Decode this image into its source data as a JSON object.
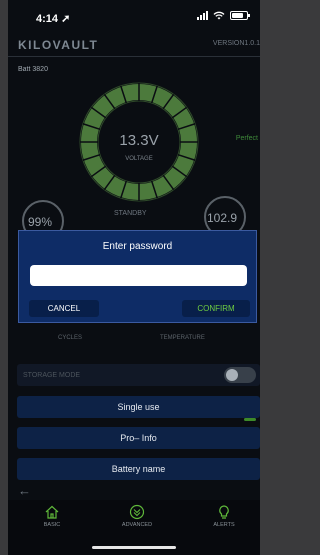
{
  "status_bar": {
    "time": "4:14 ➚"
  },
  "header": {
    "logo": "KILOVAULT",
    "version": "VERSION1.0.1"
  },
  "device": {
    "name": "Batt 3820",
    "health_text": "Perfect"
  },
  "gauge": {
    "voltage_value": "13.3V",
    "voltage_label": "VOLTAGE",
    "state": "STANDBY"
  },
  "stats": {
    "left_ring_value": "99%",
    "right_ring_value": "102.9",
    "cycles_label": "CYCLES",
    "temperature_label": "TEMPERATURE"
  },
  "dialog": {
    "title": "Enter password",
    "password_value": "",
    "cancel_label": "CANCEL",
    "confirm_label": "CONFIRM"
  },
  "menu": {
    "storage_mode_label": "STORAGE MODE",
    "single_use_label": "Single use",
    "pro_info_label": "Pro– Info",
    "battery_name_label": "Battery name"
  },
  "nav": {
    "basic_label": "BASIC",
    "advanced_label": "ADVANCED",
    "alerts_label": "ALERTS"
  },
  "colors": {
    "accent_green": "#6fce42",
    "dialog_blue": "#0e2c66",
    "row_blue": "#0d2246"
  }
}
